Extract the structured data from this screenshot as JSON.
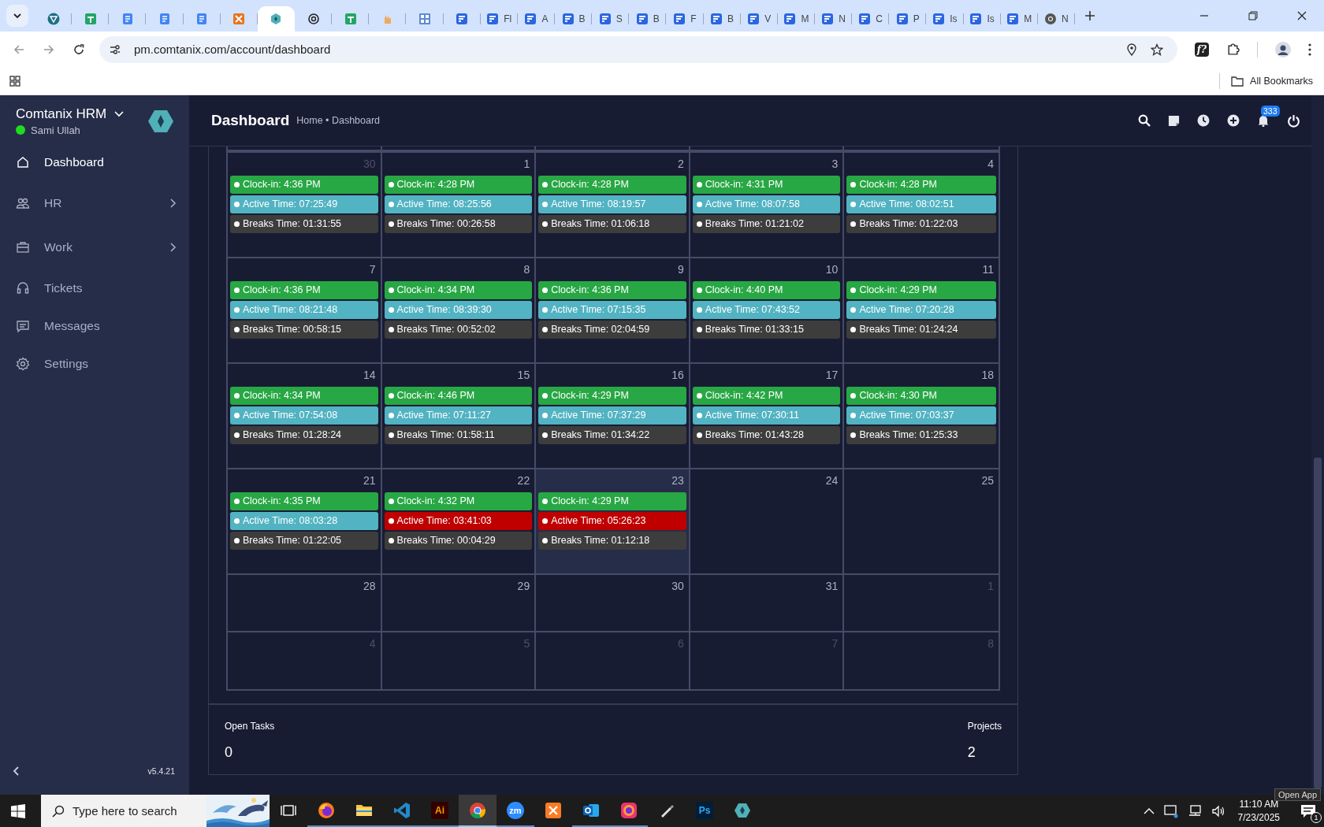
{
  "browser": {
    "tabs": [
      {
        "kind": "vpn",
        "selected": false
      },
      {
        "kind": "sheets",
        "selected": false
      },
      {
        "kind": "docs",
        "selected": false
      },
      {
        "kind": "docs",
        "selected": false
      },
      {
        "kind": "docs",
        "selected": false
      },
      {
        "kind": "xampp",
        "selected": false
      },
      {
        "kind": "app",
        "selected": true
      },
      {
        "kind": "openai",
        "selected": false
      },
      {
        "kind": "sheets",
        "selected": false
      },
      {
        "kind": "hand",
        "selected": false
      },
      {
        "kind": "repo",
        "selected": false
      },
      {
        "kind": "form",
        "selected": false
      },
      {
        "kind": "form",
        "label": "Fl",
        "selected": false
      },
      {
        "kind": "form",
        "label": "A",
        "selected": false
      },
      {
        "kind": "form",
        "label": "B",
        "selected": false
      },
      {
        "kind": "form",
        "label": "S",
        "selected": false
      },
      {
        "kind": "form",
        "label": "B",
        "selected": false
      },
      {
        "kind": "form",
        "label": "F",
        "selected": false
      },
      {
        "kind": "form",
        "label": "B",
        "selected": false
      },
      {
        "kind": "form",
        "label": "V",
        "selected": false
      },
      {
        "kind": "form",
        "label": "M",
        "selected": false
      },
      {
        "kind": "form",
        "label": "N",
        "selected": false
      },
      {
        "kind": "form",
        "label": "C",
        "selected": false
      },
      {
        "kind": "form",
        "label": "P",
        "selected": false
      },
      {
        "kind": "form",
        "label": "Is",
        "selected": false
      },
      {
        "kind": "form",
        "label": "Is",
        "selected": false
      },
      {
        "kind": "form",
        "label": "M",
        "selected": false
      },
      {
        "kind": "chrome",
        "label": "N",
        "selected": false
      }
    ],
    "address": "pm.comtanix.com/account/dashboard",
    "extension_label": "f?",
    "bookmarks_label": "All Bookmarks"
  },
  "sidebar": {
    "brand": "Comtanix HRM",
    "user": "Sami Ullah",
    "online": true,
    "items": [
      {
        "kind": "home",
        "label": "Dashboard",
        "selected": true,
        "expandable": false
      },
      {
        "kind": "users",
        "label": "HR",
        "selected": false,
        "expandable": true
      },
      {
        "kind": "briefcase",
        "label": "Work",
        "selected": false,
        "expandable": true
      },
      {
        "kind": "headset",
        "label": "Tickets",
        "selected": false,
        "expandable": false
      },
      {
        "kind": "chat",
        "label": "Messages",
        "selected": false,
        "expandable": false
      },
      {
        "kind": "gear",
        "label": "Settings",
        "selected": false,
        "expandable": false
      }
    ],
    "version": "v5.4.21"
  },
  "header": {
    "title": "Dashboard",
    "breadcrumb": "Home • Dashboard",
    "notification_count": "333"
  },
  "calendar": {
    "weeks": [
      {
        "days": [
          {
            "day": "30",
            "muted": true,
            "today": false,
            "events": [
              {
                "color": "#28a745",
                "text": "Clock-in: 4:36 PM"
              },
              {
                "color": "#52b3c2",
                "text": "Active Time: 07:25:49"
              },
              {
                "color": "#3d3d3d",
                "text": "Breaks Time: 01:31:55"
              }
            ]
          },
          {
            "day": "1",
            "muted": false,
            "today": false,
            "events": [
              {
                "color": "#28a745",
                "text": "Clock-in: 4:28 PM"
              },
              {
                "color": "#52b3c2",
                "text": "Active Time: 08:25:56"
              },
              {
                "color": "#3d3d3d",
                "text": "Breaks Time: 00:26:58"
              }
            ]
          },
          {
            "day": "2",
            "muted": false,
            "today": false,
            "events": [
              {
                "color": "#28a745",
                "text": "Clock-in: 4:28 PM"
              },
              {
                "color": "#52b3c2",
                "text": "Active Time: 08:19:57"
              },
              {
                "color": "#3d3d3d",
                "text": "Breaks Time: 01:06:18"
              }
            ]
          },
          {
            "day": "3",
            "muted": false,
            "today": false,
            "events": [
              {
                "color": "#28a745",
                "text": "Clock-in: 4:31 PM"
              },
              {
                "color": "#52b3c2",
                "text": "Active Time: 08:07:58"
              },
              {
                "color": "#3d3d3d",
                "text": "Breaks Time: 01:21:02"
              }
            ]
          },
          {
            "day": "4",
            "muted": false,
            "today": false,
            "events": [
              {
                "color": "#28a745",
                "text": "Clock-in: 4:28 PM"
              },
              {
                "color": "#52b3c2",
                "text": "Active Time: 08:02:51"
              },
              {
                "color": "#3d3d3d",
                "text": "Breaks Time: 01:22:03"
              }
            ]
          }
        ]
      },
      {
        "days": [
          {
            "day": "7",
            "muted": false,
            "today": false,
            "events": [
              {
                "color": "#28a745",
                "text": "Clock-in: 4:36 PM"
              },
              {
                "color": "#52b3c2",
                "text": "Active Time: 08:21:48"
              },
              {
                "color": "#3d3d3d",
                "text": "Breaks Time: 00:58:15"
              }
            ]
          },
          {
            "day": "8",
            "muted": false,
            "today": false,
            "events": [
              {
                "color": "#28a745",
                "text": "Clock-in: 4:34 PM"
              },
              {
                "color": "#52b3c2",
                "text": "Active Time: 08:39:30"
              },
              {
                "color": "#3d3d3d",
                "text": "Breaks Time: 00:52:02"
              }
            ]
          },
          {
            "day": "9",
            "muted": false,
            "today": false,
            "events": [
              {
                "color": "#28a745",
                "text": "Clock-in: 4:36 PM"
              },
              {
                "color": "#52b3c2",
                "text": "Active Time: 07:15:35"
              },
              {
                "color": "#3d3d3d",
                "text": "Breaks Time: 02:04:59"
              }
            ]
          },
          {
            "day": "10",
            "muted": false,
            "today": false,
            "events": [
              {
                "color": "#28a745",
                "text": "Clock-in: 4:40 PM"
              },
              {
                "color": "#52b3c2",
                "text": "Active Time: 07:43:52"
              },
              {
                "color": "#3d3d3d",
                "text": "Breaks Time: 01:33:15"
              }
            ]
          },
          {
            "day": "11",
            "muted": false,
            "today": false,
            "events": [
              {
                "color": "#28a745",
                "text": "Clock-in: 4:29 PM"
              },
              {
                "color": "#52b3c2",
                "text": "Active Time: 07:20:28"
              },
              {
                "color": "#3d3d3d",
                "text": "Breaks Time: 01:24:24"
              }
            ]
          }
        ]
      },
      {
        "days": [
          {
            "day": "14",
            "muted": false,
            "today": false,
            "events": [
              {
                "color": "#28a745",
                "text": "Clock-in: 4:34 PM"
              },
              {
                "color": "#52b3c2",
                "text": "Active Time: 07:54:08"
              },
              {
                "color": "#3d3d3d",
                "text": "Breaks Time: 01:28:24"
              }
            ]
          },
          {
            "day": "15",
            "muted": false,
            "today": false,
            "events": [
              {
                "color": "#28a745",
                "text": "Clock-in: 4:46 PM"
              },
              {
                "color": "#52b3c2",
                "text": "Active Time: 07:11:27"
              },
              {
                "color": "#3d3d3d",
                "text": "Breaks Time: 01:58:11"
              }
            ]
          },
          {
            "day": "16",
            "muted": false,
            "today": false,
            "events": [
              {
                "color": "#28a745",
                "text": "Clock-in: 4:29 PM"
              },
              {
                "color": "#52b3c2",
                "text": "Active Time: 07:37:29"
              },
              {
                "color": "#3d3d3d",
                "text": "Breaks Time: 01:34:22"
              }
            ]
          },
          {
            "day": "17",
            "muted": false,
            "today": false,
            "events": [
              {
                "color": "#28a745",
                "text": "Clock-in: 4:42 PM"
              },
              {
                "color": "#52b3c2",
                "text": "Active Time: 07:30:11"
              },
              {
                "color": "#3d3d3d",
                "text": "Breaks Time: 01:43:28"
              }
            ]
          },
          {
            "day": "18",
            "muted": false,
            "today": false,
            "events": [
              {
                "color": "#28a745",
                "text": "Clock-in: 4:30 PM"
              },
              {
                "color": "#52b3c2",
                "text": "Active Time: 07:03:37"
              },
              {
                "color": "#3d3d3d",
                "text": "Breaks Time: 01:25:33"
              }
            ]
          }
        ]
      },
      {
        "days": [
          {
            "day": "21",
            "muted": false,
            "today": false,
            "events": [
              {
                "color": "#28a745",
                "text": "Clock-in: 4:35 PM"
              },
              {
                "color": "#52b3c2",
                "text": "Active Time: 08:03:28"
              },
              {
                "color": "#3d3d3d",
                "text": "Breaks Time: 01:22:05"
              }
            ]
          },
          {
            "day": "22",
            "muted": false,
            "today": false,
            "events": [
              {
                "color": "#28a745",
                "text": "Clock-in: 4:32 PM"
              },
              {
                "color": "#c00000",
                "text": "Active Time: 03:41:03"
              },
              {
                "color": "#3d3d3d",
                "text": "Breaks Time: 00:04:29"
              }
            ]
          },
          {
            "day": "23",
            "muted": false,
            "today": true,
            "events": [
              {
                "color": "#28a745",
                "text": "Clock-in: 4:29 PM"
              },
              {
                "color": "#c00000",
                "text": "Active Time: 05:26:23"
              },
              {
                "color": "#3d3d3d",
                "text": "Breaks Time: 01:12:18"
              }
            ]
          },
          {
            "day": "24",
            "muted": false,
            "today": false
          },
          {
            "day": "25",
            "muted": false,
            "today": false
          }
        ]
      },
      {
        "days": [
          {
            "day": "28",
            "muted": false,
            "today": false
          },
          {
            "day": "29",
            "muted": false,
            "today": false
          },
          {
            "day": "30",
            "muted": false,
            "today": false
          },
          {
            "day": "31",
            "muted": false,
            "today": false
          },
          {
            "day": "1",
            "muted": true,
            "today": false
          }
        ]
      },
      {
        "days": [
          {
            "day": "4",
            "muted": true,
            "today": false
          },
          {
            "day": "5",
            "muted": true,
            "today": false
          },
          {
            "day": "6",
            "muted": true,
            "today": false
          },
          {
            "day": "7",
            "muted": true,
            "today": false
          },
          {
            "day": "8",
            "muted": true,
            "today": false
          }
        ]
      }
    ]
  },
  "summary": [
    {
      "label": "Open Tasks",
      "value": "0"
    },
    {
      "label": "Projects",
      "value": "2"
    }
  ],
  "taskbar": {
    "search_placeholder": "Type here to search",
    "apps": [
      {
        "kind": "taskview",
        "selected": false,
        "running": false
      },
      {
        "kind": "firefox",
        "selected": false,
        "running": true
      },
      {
        "kind": "explorer",
        "selected": false,
        "running": true
      },
      {
        "kind": "vscode",
        "selected": false,
        "running": true
      },
      {
        "kind": "illustrator",
        "label": "Ai",
        "selected": false,
        "running": true
      },
      {
        "kind": "chrome",
        "selected": true,
        "running": true
      },
      {
        "kind": "zoom",
        "label": "zm",
        "selected": false,
        "running": true
      },
      {
        "kind": "xampp",
        "selected": false,
        "running": false
      },
      {
        "kind": "outlook",
        "selected": false,
        "running": true
      },
      {
        "kind": "cloud",
        "selected": false,
        "running": true
      },
      {
        "kind": "pen",
        "selected": false,
        "running": false
      },
      {
        "kind": "photoshop",
        "label": "Ps",
        "selected": false,
        "running": false
      },
      {
        "kind": "app",
        "selected": false,
        "running": false
      }
    ],
    "tooltip": "Open App",
    "time": "11:10 AM",
    "date": "7/23/2025",
    "notification_count": "1"
  }
}
